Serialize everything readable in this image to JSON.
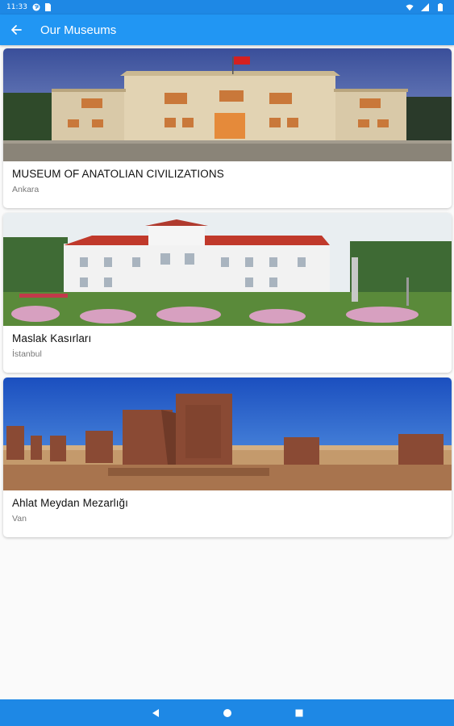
{
  "status_bar": {
    "time": "11:33",
    "icons_left": [
      "notification-app-icon",
      "sim-card-icon"
    ],
    "icons_right": [
      "wifi-icon",
      "signal-icon",
      "battery-icon"
    ]
  },
  "app_bar": {
    "title": "Our Museums",
    "back_icon": "arrow-back-icon"
  },
  "museums": [
    {
      "name": "MUSEUM OF ANATOLIAN CIVILIZATIONS",
      "city": "Ankara"
    },
    {
      "name": "Maslak Kasırları",
      "city": "İstanbul"
    },
    {
      "name": "Ahlat Meydan Mezarlığı",
      "city": "Van"
    }
  ],
  "nav_bar": {
    "buttons": [
      "back-triangle-icon",
      "home-circle-icon",
      "recents-square-icon"
    ]
  },
  "colors": {
    "primary": "#2196f3",
    "status": "#1e88e5",
    "background": "#fafafa"
  }
}
